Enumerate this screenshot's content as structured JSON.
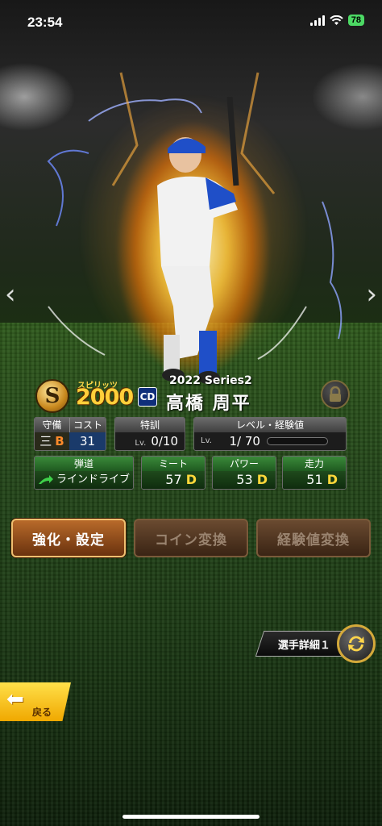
{
  "status_bar": {
    "time": "23:54",
    "battery": "78"
  },
  "card": {
    "spirit_label": "スピリッツ",
    "spirit_value": "2000",
    "team_logo": "CD",
    "series": "2022 Series2",
    "player_name": "高橋 周平"
  },
  "stats": {
    "position": {
      "header": "守備",
      "value": "三",
      "grade": "B"
    },
    "cost": {
      "header": "コスト",
      "value": "31"
    },
    "training": {
      "header": "特訓",
      "lv_label": "Lv.",
      "value": "0/10"
    },
    "level": {
      "header": "レベル・経験値",
      "lv_label": "Lv.",
      "value": "1/ 70",
      "exp_fraction": 0
    },
    "trajectory": {
      "header": "弾道",
      "value": "ラインドライブ"
    },
    "meet": {
      "header": "ミート",
      "value": "57",
      "grade": "D"
    },
    "power": {
      "header": "パワー",
      "value": "53",
      "grade": "D"
    },
    "speed": {
      "header": "走力",
      "value": "51",
      "grade": "D"
    }
  },
  "actions": {
    "enhance": "強化・設定",
    "coin": "コイン変換",
    "exp": "経験値変換"
  },
  "detail_label": "選手詳細１",
  "back_label": "戻る",
  "icons": [
    "signal-icon",
    "wifi-icon",
    "battery-icon",
    "lock-icon",
    "refresh-icon",
    "left-arrow-icon",
    "right-arrow-icon",
    "back-arrow-icon"
  ]
}
